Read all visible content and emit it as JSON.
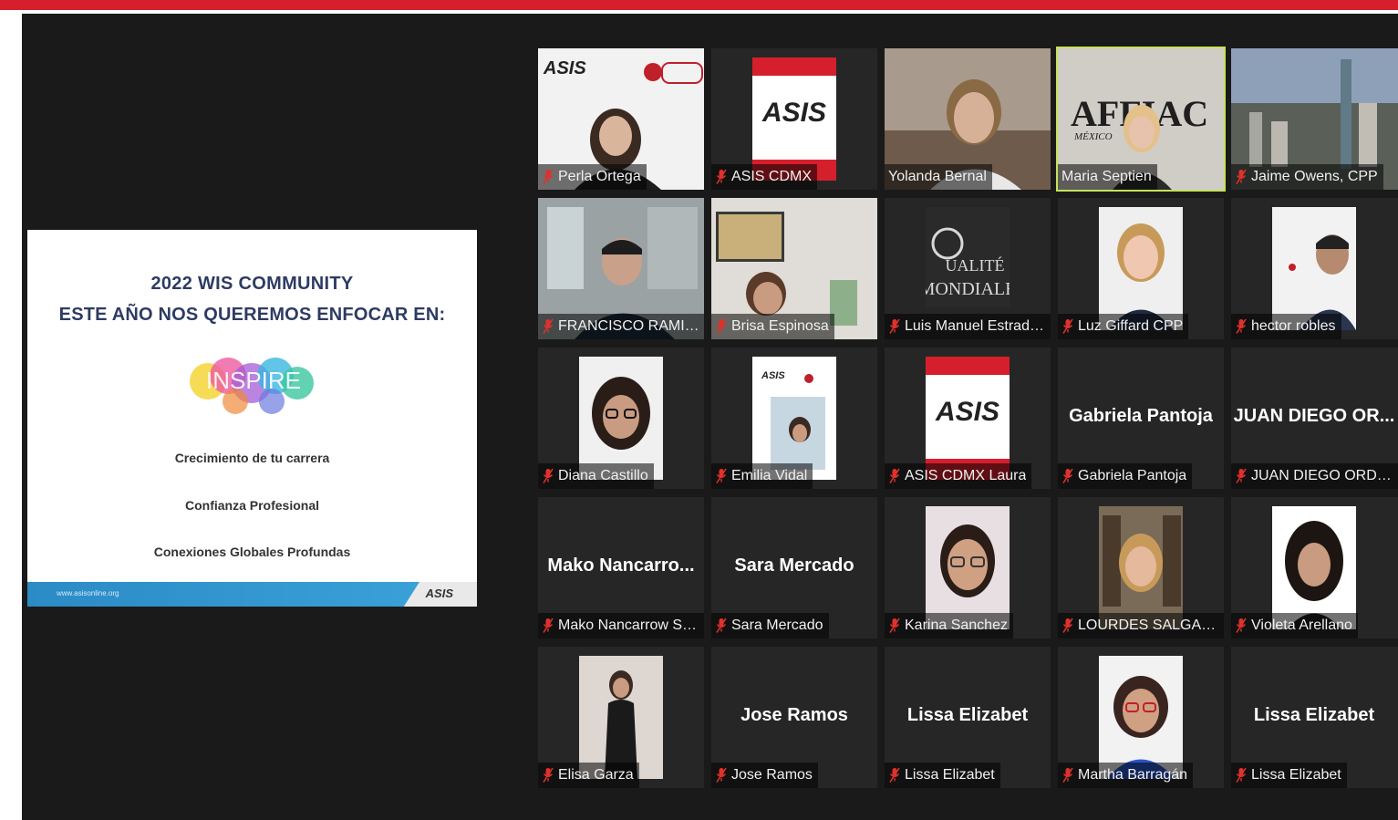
{
  "slide": {
    "title_line1": "2022 WIS COMMUNITY",
    "title_line2": "ESTE AÑO NOS QUEREMOS ENFOCAR EN:",
    "inspire_text": "INSPIRE",
    "bullets": [
      "Crecimiento de tu carrera",
      "Confianza Profesional",
      "Conexiones Globales Profundas"
    ],
    "footer_url": "www.asisonline.org",
    "footer_logo": "ASIS"
  },
  "participants": [
    {
      "name": "Perla Ortega",
      "muted": true,
      "video": true
    },
    {
      "name": "ASIS CDMX",
      "muted": true,
      "video": true
    },
    {
      "name": "Yolanda Bernal",
      "muted": false,
      "video": true
    },
    {
      "name": "Maria Septien",
      "muted": false,
      "video": true,
      "active": true
    },
    {
      "name": "Jaime Owens, CPP",
      "muted": true,
      "video": true
    },
    {
      "name": "FRANCISCO RAMIREZ",
      "muted": true,
      "video": true
    },
    {
      "name": "Brisa Espinosa",
      "muted": true,
      "video": true
    },
    {
      "name": "Luis Manuel Estrada ...",
      "muted": true,
      "video": true
    },
    {
      "name": "Luz Giffard CPP",
      "muted": true,
      "video": true
    },
    {
      "name": "hector robles",
      "muted": true,
      "video": true
    },
    {
      "name": "Diana Castillo",
      "muted": true,
      "video": true
    },
    {
      "name": "Emilia Vidal",
      "muted": true,
      "video": true
    },
    {
      "name": "ASIS CDMX Laura",
      "muted": true,
      "video": true
    },
    {
      "name": "Gabriela Pantoja",
      "muted": true,
      "video": false,
      "display_name": "Gabriela Pantoja"
    },
    {
      "name": "JUAN DIEGO ORDAZ",
      "muted": true,
      "video": false,
      "display_name": "JUAN DIEGO OR..."
    },
    {
      "name": "Mako Nancarrow Su...",
      "muted": true,
      "video": false,
      "display_name": "Mako  Nancarro..."
    },
    {
      "name": "Sara Mercado",
      "muted": true,
      "video": false,
      "display_name": "Sara Mercado"
    },
    {
      "name": "Karina Sanchez",
      "muted": true,
      "video": true
    },
    {
      "name": "LOURDES SALGADO",
      "muted": true,
      "video": true
    },
    {
      "name": "Violeta Arellano",
      "muted": true,
      "video": true
    },
    {
      "name": "Elisa Garza",
      "muted": true,
      "video": true
    },
    {
      "name": "Jose Ramos",
      "muted": true,
      "video": false,
      "display_name": "Jose Ramos"
    },
    {
      "name": "Lissa Elizabet",
      "muted": true,
      "video": false,
      "display_name": "Lissa Elizabet"
    },
    {
      "name": "Martha Barragán",
      "muted": true,
      "video": true
    },
    {
      "name": "Lissa Elizabet",
      "muted": true,
      "video": false,
      "display_name": "Lissa Elizabet"
    }
  ],
  "video_text": {
    "asis_logo": "ASIS",
    "affiac": "AFFIAC",
    "mexico": "MÉXICO",
    "qualite_line1": "UALITÉ",
    "qualite_line2": "MONDIALE"
  },
  "colors": {
    "top_bar": "#d61f2c",
    "stage_bg": "#1a1a1a",
    "tile_bg": "#262626",
    "active_speaker": "#c4e25a",
    "muted_icon": "#e0312b"
  }
}
